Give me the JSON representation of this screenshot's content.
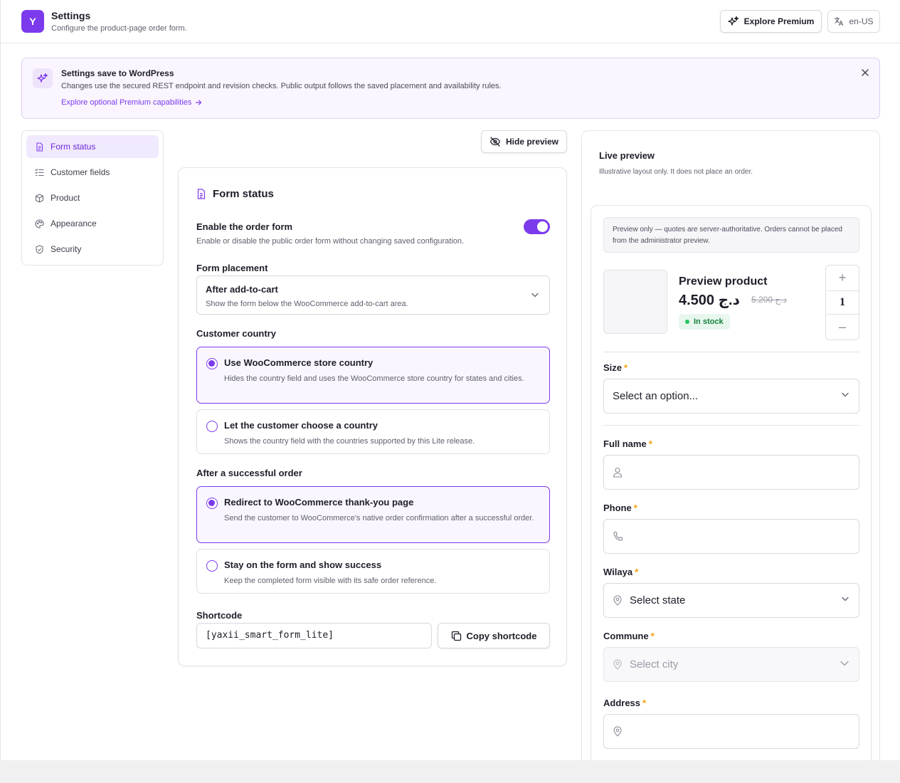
{
  "header": {
    "logo": "Y",
    "title": "Settings",
    "subtitle": "Configure the product-page order form.",
    "premium_label": "Explore Premium",
    "lang_label": "en-US"
  },
  "banner": {
    "title": "Settings save to WordPress",
    "text": "Changes use the secured REST endpoint and revision checks. Public output follows the saved placement and availability rules.",
    "link": "Explore optional Premium capabilities"
  },
  "sidebar": {
    "items": [
      {
        "label": "Form status",
        "icon": "document-icon"
      },
      {
        "label": "Customer fields",
        "icon": "list-check-icon"
      },
      {
        "label": "Product",
        "icon": "box-icon"
      },
      {
        "label": "Appearance",
        "icon": "palette-icon"
      },
      {
        "label": "Security",
        "icon": "shield-icon"
      }
    ]
  },
  "toolbar": {
    "hide_preview": "Hide preview"
  },
  "form": {
    "title": "Form status",
    "enable": {
      "label": "Enable the order form",
      "hint": "Enable or disable the public order form without changing saved configuration.",
      "value": true
    },
    "placement": {
      "label": "Form placement",
      "value": "After add-to-cart",
      "hint": "Show the form below the WooCommerce add-to-cart area."
    },
    "country": {
      "label": "Customer country",
      "options": [
        {
          "title": "Use WooCommerce store country",
          "desc": "Hides the country field and uses the WooCommerce store country for states and cities.",
          "selected": true
        },
        {
          "title": "Let the customer choose a country",
          "desc": "Shows the country field with the countries supported by this Lite release.",
          "selected": false
        }
      ]
    },
    "after_order": {
      "label": "After a successful order",
      "options": [
        {
          "title": "Redirect to WooCommerce thank-you page",
          "desc": "Send the customer to WooCommerce's native order confirmation after a successful order.",
          "selected": true
        },
        {
          "title": "Stay on the form and show success",
          "desc": "Keep the completed form visible with its safe order reference.",
          "selected": false
        }
      ]
    },
    "shortcode": {
      "label": "Shortcode",
      "value": "[yaxii_smart_form_lite]",
      "copy_label": "Copy shortcode"
    }
  },
  "preview": {
    "title": "Live preview",
    "subtitle": "Illustrative layout only. It does not place an order.",
    "note": "Preview only — quotes are server-authoritative. Orders cannot be placed from the administrator preview.",
    "product": {
      "name": "Preview product",
      "price": "4.500 د.ج",
      "old_price": "5.200 د.ج",
      "stock": "In stock",
      "qty": "1",
      "qty_plus": "+",
      "qty_minus": "–"
    },
    "fields": [
      {
        "label": "Size",
        "req": "*",
        "placeholder": "Select an option...",
        "type": "select"
      },
      {
        "label": "Full name",
        "req": "*",
        "placeholder": "",
        "type": "text",
        "icon": "user-icon"
      },
      {
        "label": "Phone",
        "req": "*",
        "placeholder": "",
        "type": "text",
        "icon": "phone-icon"
      },
      {
        "label": "Wilaya",
        "req": "*",
        "placeholder": "Select state",
        "type": "select",
        "icon": "location-icon"
      },
      {
        "label": "Commune",
        "req": "*",
        "placeholder": "Select city",
        "type": "select",
        "icon": "location-icon",
        "disabled": true
      },
      {
        "label": "Address",
        "req": "*",
        "placeholder": "",
        "type": "text",
        "icon": "location-icon"
      }
    ]
  },
  "colors": {
    "accent": "#7c3aed",
    "accent_soft": "#f1e9fd",
    "success": "#15803d",
    "required": "#f59e0b"
  }
}
